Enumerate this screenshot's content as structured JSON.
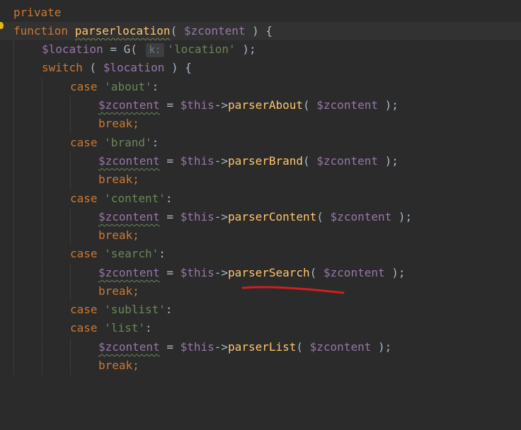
{
  "colors": {
    "background": "#2b2b2b",
    "current_line": "#323232",
    "keyword": "#cc7832",
    "variable": "#9876aa",
    "function": "#ffc66d",
    "string": "#6a8759",
    "default": "#a9b7c6",
    "annotation": "#d21f1f"
  },
  "icons": {
    "gutter": "lightbulb-icon"
  },
  "code": {
    "l1": {
      "kw": "private"
    },
    "l2": {
      "kw": "function",
      "fn": "parserlocation",
      "p1": "( ",
      "var": "$zcontent",
      "p2": " ) {"
    },
    "l3": {
      "var": "$location",
      "eq": " = G( ",
      "hint": "k:",
      "str": "'location'",
      "close": " );"
    },
    "l4": {
      "kw": "switch",
      "p1": " ( ",
      "var": "$location",
      "p2": " ) {"
    },
    "l5": {
      "kw": "case",
      "str": "'about'",
      "colon": ":"
    },
    "l6": {
      "var1": "$zcontent",
      "eq": " = ",
      "var2": "$this",
      "arrow": "->",
      "fn": "parserAbout",
      "p1": "( ",
      "var3": "$zcontent",
      "p2": " );"
    },
    "l7": {
      "kw": "break",
      "semi": ";"
    },
    "l8": {
      "kw": "case",
      "str": "'brand'",
      "colon": ":"
    },
    "l9": {
      "var1": "$zcontent",
      "eq": " = ",
      "var2": "$this",
      "arrow": "->",
      "fn": "parserBrand",
      "p1": "( ",
      "var3": "$zcontent",
      "p2": " );"
    },
    "l10": {
      "kw": "break",
      "semi": ";"
    },
    "l11": {
      "kw": "case",
      "str": "'content'",
      "colon": ":"
    },
    "l12": {
      "var1": "$zcontent",
      "eq": " = ",
      "var2": "$this",
      "arrow": "->",
      "fn": "parserContent",
      "p1": "( ",
      "var3": "$zcontent",
      "p2": " );"
    },
    "l13": {
      "kw": "break",
      "semi": ";"
    },
    "l14": {
      "kw": "case",
      "str": "'search'",
      "colon": ":"
    },
    "l15": {
      "var1": "$zcontent",
      "eq": " = ",
      "var2": "$this",
      "arrow": "->",
      "fn": "parserSearch",
      "p1": "( ",
      "var3": "$zcontent",
      "p2": " );"
    },
    "l16": {
      "kw": "break",
      "semi": ";"
    },
    "l17": {
      "kw": "case",
      "str": "'sublist'",
      "colon": ":"
    },
    "l18": {
      "kw": "case",
      "str": "'list'",
      "colon": ":"
    },
    "l19": {
      "var1": "$zcontent",
      "eq": " = ",
      "var2": "$this",
      "arrow": "->",
      "fn": "parserList",
      "p1": "( ",
      "var3": "$zcontent",
      "p2": " );"
    },
    "l20": {
      "kw": "break",
      "semi": ";"
    }
  }
}
